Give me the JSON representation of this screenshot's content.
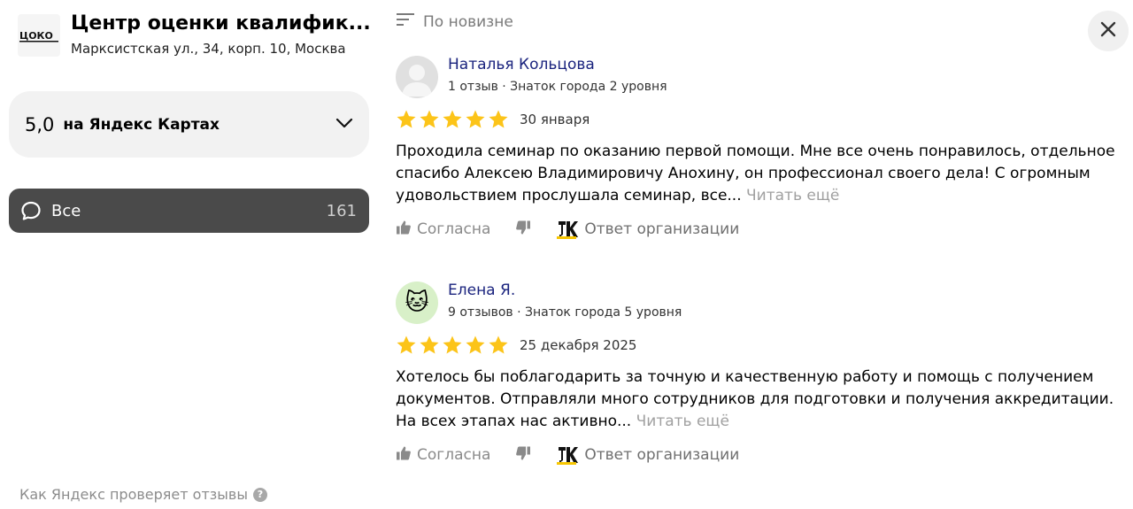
{
  "organization": {
    "logo_text": "ЦОКО",
    "title": "Центр оценки квалифик...",
    "address": "Марксистская ул., 34, корп. 10, Москва"
  },
  "rating": {
    "value": "5,0",
    "source": "на Яндекс Картах"
  },
  "filter": {
    "label": "Все",
    "count": "161"
  },
  "verify_link": "Как Яндекс проверяет отзывы",
  "sort": {
    "label": "По новизне"
  },
  "reviews": [
    {
      "author": "Наталья Кольцова",
      "meta": "1 отзыв · Знаток города 2 уровня",
      "stars": 5,
      "date": "30 января",
      "text": "Проходила семинар по оказанию первой помощи. Мне все очень понравилось, отдельное спасибо Алексею Владимировичу Анохину, он профессионал своего дела! С огромным удовольствием прослушала семинар, все...",
      "read_more": "Читать ещё",
      "agree_label": "Согласна",
      "org_reply_label": "Ответ организации"
    },
    {
      "author": "Елена Я.",
      "meta": "9 отзывов · Знаток города 5 уровня",
      "stars": 5,
      "date": "25 декабря 2025",
      "text": "Хотелось бы поблагодарить за точную и качественную работу и помощь с получением документов. Отправляли много сотрудников для подготовки и получения аккредитации. На всех этапах нас активно...",
      "read_more": "Читать ещё",
      "agree_label": "Согласна",
      "org_reply_label": "Ответ организации"
    }
  ],
  "colors": {
    "star": "#fcc419",
    "author_link": "#1a237e",
    "filter_active_bg": "#4a4a4a",
    "read_more": "#a0a0a0"
  }
}
